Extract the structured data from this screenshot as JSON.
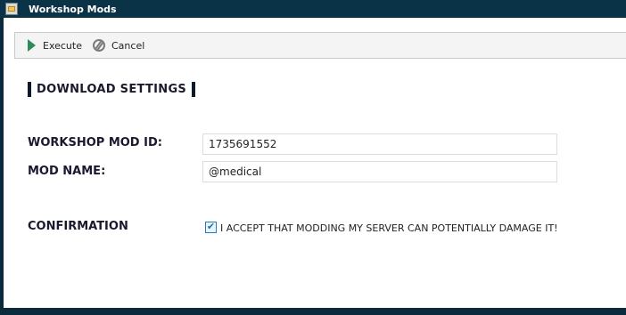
{
  "window": {
    "title": "Workshop Mods",
    "icon": "app-folder-icon"
  },
  "toolbar": {
    "execute": {
      "label": "Execute",
      "icon": "play-icon"
    },
    "cancel": {
      "label": "Cancel",
      "icon": "cancel-icon"
    }
  },
  "section": {
    "title": "DOWNLOAD SETTINGS"
  },
  "form": {
    "mod_id": {
      "label": "WORKSHOP MOD ID:",
      "value": "1735691552"
    },
    "mod_name": {
      "label": "MOD NAME:",
      "value": "@medical"
    },
    "confirmation": {
      "label": "CONFIRMATION",
      "checked": true,
      "text": "I ACCEPT THAT MODDING MY SERVER CAN POTENTIALLY DAMAGE IT!"
    }
  },
  "colors": {
    "titlebar": "#0b3347",
    "accent_bar": "#0a1a2b",
    "execute_green": "#2e8b57",
    "checkbox_blue": "#2a7ab5"
  }
}
